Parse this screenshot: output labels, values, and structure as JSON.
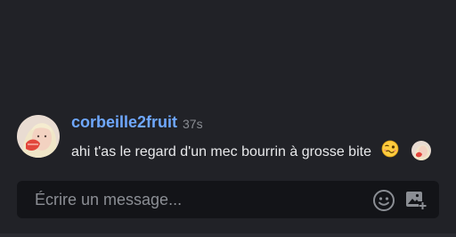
{
  "message": {
    "username": "corbeille2fruit",
    "timestamp": "37s",
    "text": "ahi t'as le regard d'un mec bourrin à grosse bite",
    "emoji": "woozy-face-emoji",
    "read_receipt": "user-avatar"
  },
  "composer": {
    "placeholder": "Écrire un message..."
  },
  "icons": {
    "emoji_button": "smiley-icon",
    "image_button": "add-image-icon"
  },
  "colors": {
    "background": "#212227",
    "composer_background": "#131418",
    "username": "#6fa8ff",
    "timestamp": "#8a8d93",
    "text": "#e8e9eb"
  }
}
